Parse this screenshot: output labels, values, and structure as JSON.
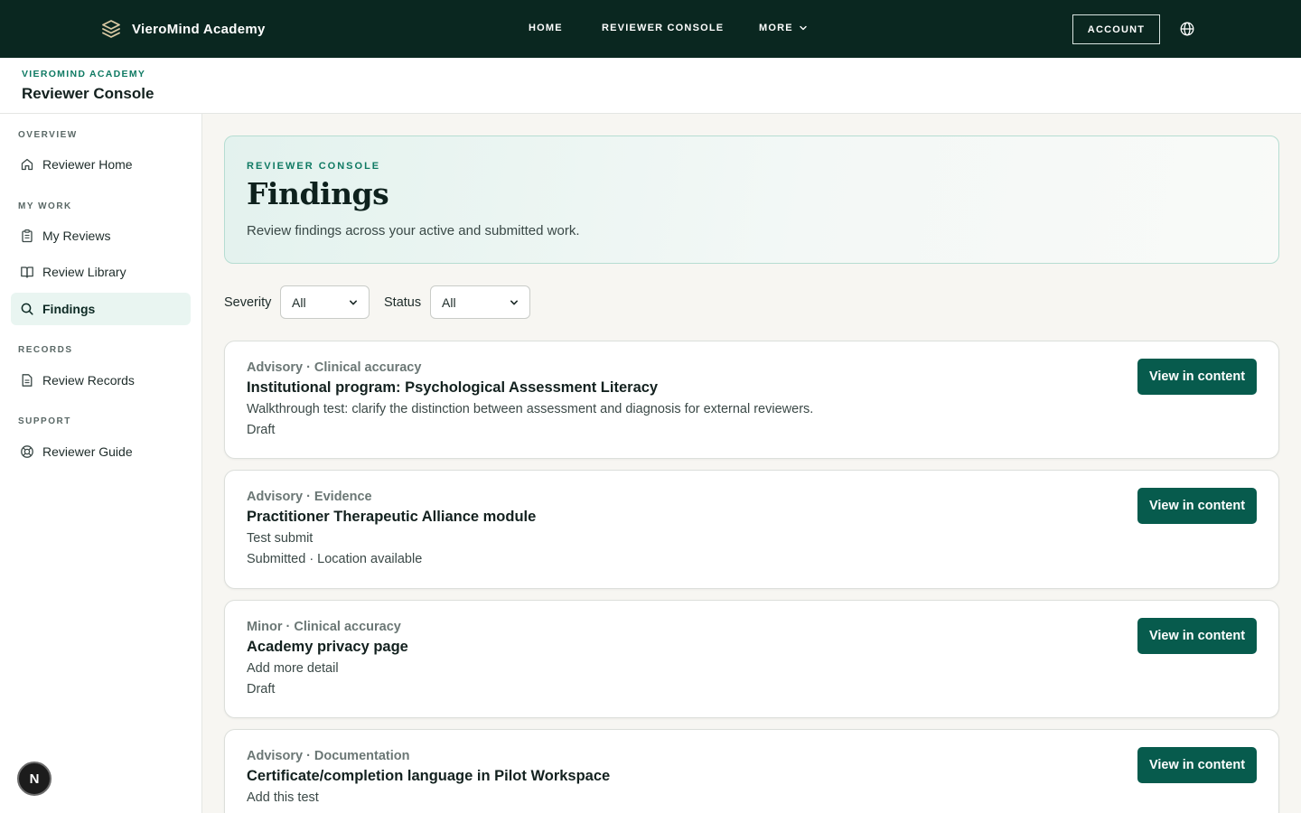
{
  "nav": {
    "brand": "VieroMind Academy",
    "links": [
      "HOME",
      "REVIEWER CONSOLE",
      "MORE"
    ],
    "account_label": "ACCOUNT",
    "more_icon": "chevron-down-icon",
    "globe_icon": "globe-icon"
  },
  "subheader": {
    "eyebrow": "VIEROMIND ACADEMY",
    "title": "Reviewer Console"
  },
  "sidebar": {
    "sections": [
      {
        "label": "OVERVIEW",
        "items": [
          {
            "label": "Reviewer Home",
            "icon": "home-icon"
          }
        ]
      },
      {
        "label": "MY WORK",
        "items": [
          {
            "label": "My Reviews",
            "icon": "clipboard-icon"
          },
          {
            "label": "Review Library",
            "icon": "book-icon"
          },
          {
            "label": "Findings",
            "icon": "search-icon",
            "active": true
          }
        ]
      },
      {
        "label": "RECORDS",
        "items": [
          {
            "label": "Review Records",
            "icon": "document-icon"
          }
        ]
      },
      {
        "label": "SUPPORT",
        "items": [
          {
            "label": "Reviewer Guide",
            "icon": "lifebuoy-icon"
          }
        ]
      }
    ],
    "badge": "N"
  },
  "hero": {
    "eyebrow": "REVIEWER CONSOLE",
    "title": "Findings",
    "description": "Review findings across your active and submitted work."
  },
  "filters": {
    "severity_label": "Severity",
    "severity_value": "All",
    "status_label": "Status",
    "status_value": "All"
  },
  "findings": [
    {
      "meta": "Advisory · Clinical accuracy",
      "title": "Institutional program: Psychological Assessment Literacy",
      "note": "Walkthrough test: clarify the distinction between assessment and diagnosis for external reviewers.",
      "status": "Draft",
      "action": "View in content"
    },
    {
      "meta": "Advisory · Evidence",
      "title": "Practitioner Therapeutic Alliance module",
      "note": "Test submit",
      "status": "Submitted · Location available",
      "action": "View in content"
    },
    {
      "meta": "Minor · Clinical accuracy",
      "title": "Academy privacy page",
      "note": "Add more detail",
      "status": "Draft",
      "action": "View in content"
    },
    {
      "meta": "Advisory · Documentation",
      "title": "Certificate/completion language in Pilot Workspace",
      "note": "Add this test",
      "status": "",
      "action": "View in content"
    }
  ],
  "colors": {
    "nav_bg": "#0a2720",
    "accent": "#0f7a63",
    "button_bg": "#075b4d",
    "active_item_bg": "#e9f5f1"
  }
}
